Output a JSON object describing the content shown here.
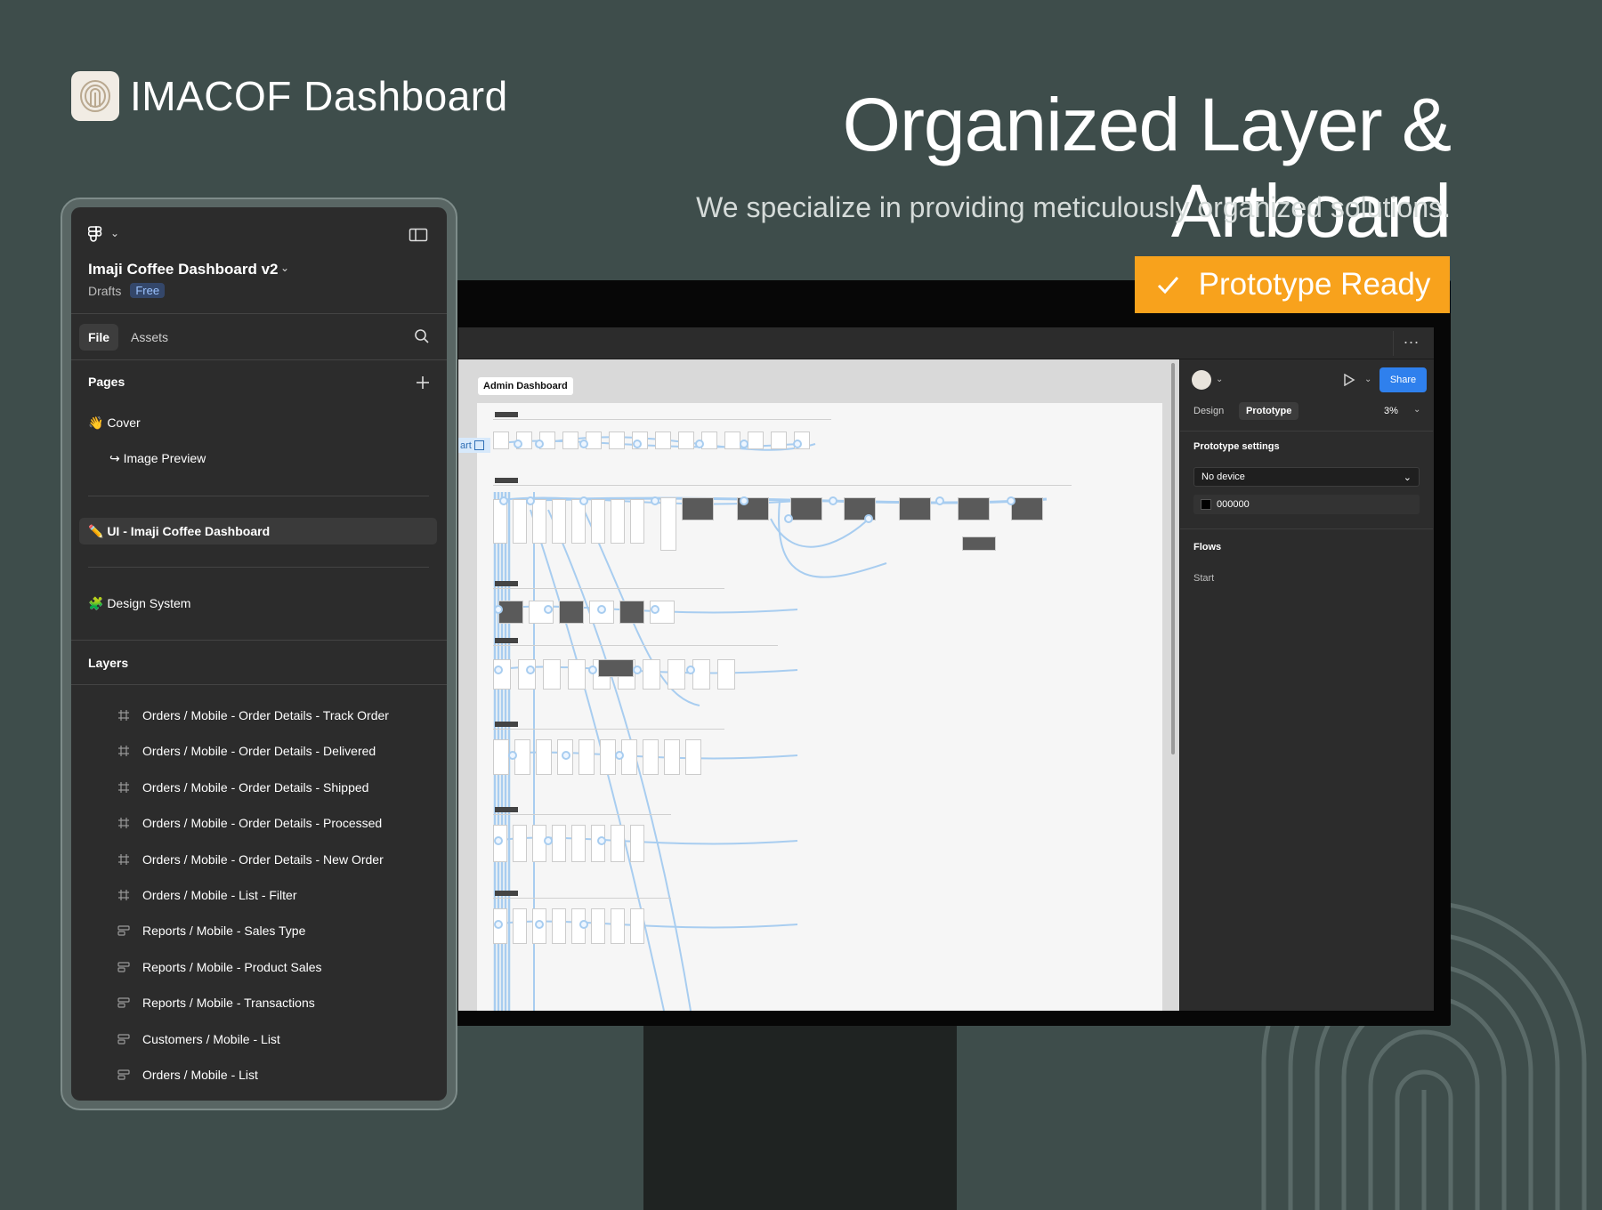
{
  "brand": {
    "name": "IMACOF Dashboard",
    "logo_icon": "fingerprint-logo-icon"
  },
  "hero": {
    "headline": "Organized Layer & Artboard",
    "subhead": "We specialize in providing meticulously organized solutions.",
    "badge": "Prototype Ready"
  },
  "colors": {
    "background": "#3e4d4b",
    "badge": "#f8a21c",
    "share": "#2f80ed",
    "panel": "#2c2c2c"
  },
  "left_panel": {
    "file_name": "Imaji Coffee Dashboard v2",
    "drafts_label": "Drafts",
    "plan_badge": "Free",
    "tabs": {
      "file": "File",
      "assets": "Assets"
    },
    "pages_heading": "Pages",
    "pages": [
      {
        "label": "👋 Cover"
      },
      {
        "label": "↪ Image Preview"
      },
      {
        "label": "✏️ UI - Imaji Coffee Dashboard"
      },
      {
        "label": "🧩 Design System"
      }
    ],
    "layers_heading": "Layers",
    "layers": [
      {
        "label": "Orders / Mobile - Order Details - Track Order",
        "icon": "frame-icon"
      },
      {
        "label": "Orders / Mobile - Order Details - Delivered",
        "icon": "frame-icon"
      },
      {
        "label": "Orders / Mobile - Order Details - Shipped",
        "icon": "frame-icon"
      },
      {
        "label": "Orders / Mobile - Order Details - Processed",
        "icon": "frame-icon"
      },
      {
        "label": "Orders / Mobile - Order Details - New Order",
        "icon": "frame-icon"
      },
      {
        "label": "Orders / Mobile - List - Filter",
        "icon": "frame-icon"
      },
      {
        "label": "Reports / Mobile - Sales Type",
        "icon": "auto-layout-icon"
      },
      {
        "label": "Reports / Mobile - Product Sales",
        "icon": "auto-layout-icon"
      },
      {
        "label": "Reports / Mobile - Transactions",
        "icon": "auto-layout-icon"
      },
      {
        "label": "Customers / Mobile - List",
        "icon": "auto-layout-icon"
      },
      {
        "label": "Orders / Mobile - List",
        "icon": "auto-layout-icon"
      }
    ]
  },
  "canvas": {
    "board_label": "Admin Dashboard",
    "flow_start_fragment": "art"
  },
  "right_panel": {
    "share_label": "Share",
    "tabs": {
      "design": "Design",
      "prototype": "Prototype"
    },
    "zoom": "3%",
    "prototype_settings_heading": "Prototype settings",
    "device_value": "No device",
    "background_color": "000000",
    "flows_heading": "Flows",
    "flows": [
      "Start"
    ]
  },
  "monitor": {
    "more_label": "···"
  }
}
